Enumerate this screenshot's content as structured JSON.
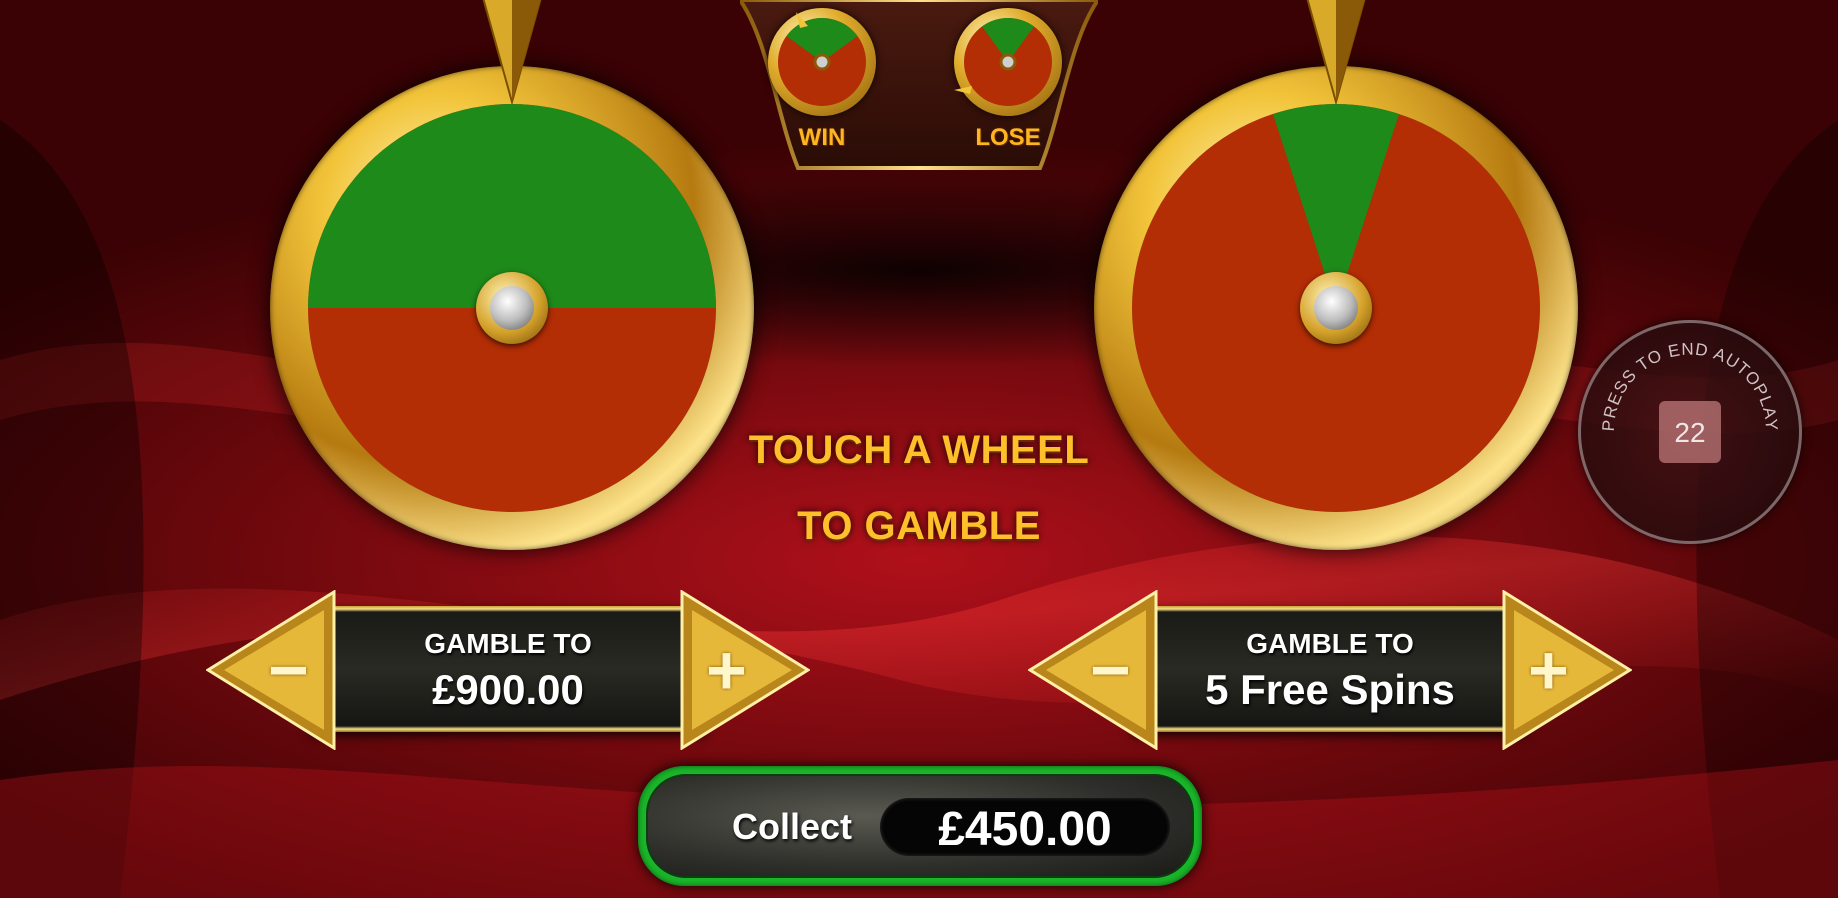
{
  "legend": {
    "win_label": "WIN",
    "lose_label": "LOSE"
  },
  "instruction": {
    "line1": "TOUCH A WHEEL",
    "line2": "TO GAMBLE"
  },
  "wheels": {
    "left": {
      "win_fraction": 0.5
    },
    "right": {
      "win_fraction": 0.1
    }
  },
  "gamble_cash": {
    "title": "GAMBLE TO",
    "value": "£900.00",
    "minus_symbol": "−",
    "plus_symbol": "+"
  },
  "gamble_spins": {
    "title": "GAMBLE TO",
    "value": "5 Free Spins",
    "minus_symbol": "−",
    "plus_symbol": "+"
  },
  "collect": {
    "label": "Collect",
    "amount": "£450.00"
  },
  "autoplay": {
    "caption": "PRESS TO END AUTOPLAY",
    "remaining": "22"
  },
  "colors": {
    "win_green": "#1e8a1a",
    "lose_red": "#b32d05",
    "gold": "#ffbf2a",
    "collect_border": "#1ab52a"
  }
}
